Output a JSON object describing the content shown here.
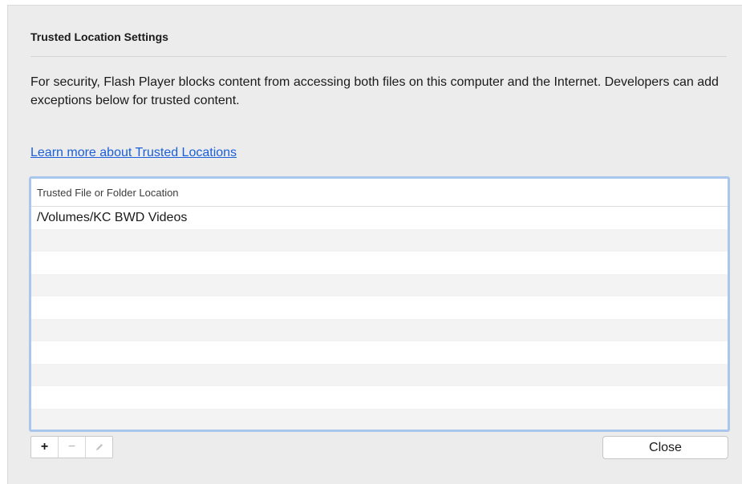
{
  "dialog": {
    "title": "Trusted Location Settings",
    "description": "For security, Flash Player blocks content from accessing both files on this computer and the Internet. Developers can add exceptions below for trusted content.",
    "learn_more_link": "Learn more about Trusted Locations"
  },
  "table": {
    "header": "Trusted File or Folder Location",
    "rows": [
      "/Volumes/KC BWD Videos",
      "",
      "",
      "",
      "",
      "",
      "",
      "",
      "",
      ""
    ]
  },
  "toolbar": {
    "add_label": "+",
    "remove_label": "−",
    "edit_icon": "pencil-icon"
  },
  "close_button": "Close",
  "colors": {
    "link": "#1b5fd8",
    "table_focus_border": "#a9c7ec",
    "panel_background": "#ececec"
  }
}
